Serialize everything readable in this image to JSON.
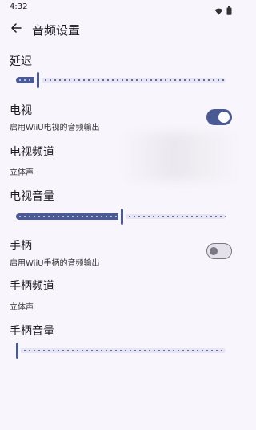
{
  "status_bar": {
    "time": "4:32",
    "icons": [
      "wifi-icon",
      "battery-icon"
    ]
  },
  "top_bar": {
    "back_icon": "arrow-left-icon",
    "title": "音频设置"
  },
  "latency": {
    "label": "延迟",
    "value_fraction": 0.1
  },
  "tv": {
    "label": "电视",
    "description": "启用WiiU电视的音频输出",
    "enabled": true
  },
  "tv_channel": {
    "label": "电视频道",
    "value": "立体声"
  },
  "tv_volume": {
    "label": "电视音量",
    "value_fraction": 0.5
  },
  "gamepad": {
    "label": "手柄",
    "description": "启用WiiU手柄的音频输出",
    "enabled": false
  },
  "gamepad_channel": {
    "label": "手柄频道",
    "value": "立体声"
  },
  "gamepad_volume": {
    "label": "手柄音量",
    "value_fraction": 0.0
  },
  "colors": {
    "accent": "#4a5a94",
    "background": "#f8f6fc",
    "track_inactive": "#e7e4f3"
  }
}
